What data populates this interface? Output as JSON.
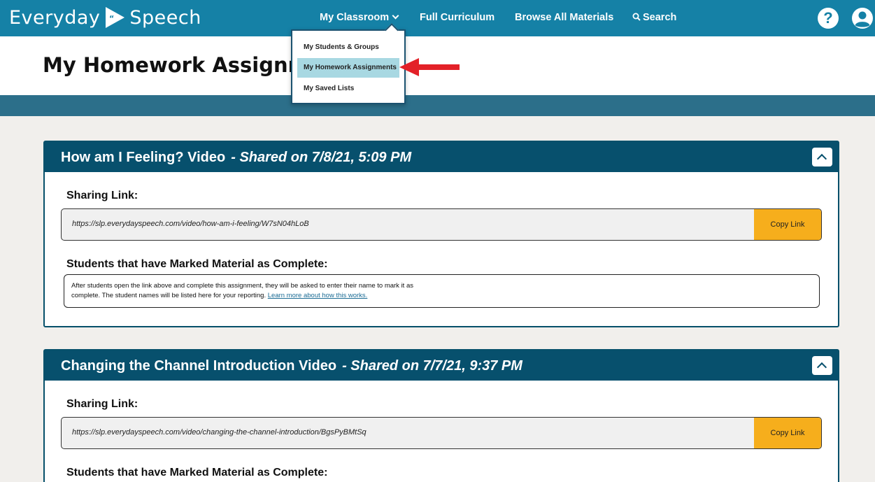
{
  "brand": {
    "name_left": "Everyday",
    "name_right": "Speech",
    "logo_icon": "play-quote-logo-icon"
  },
  "nav": {
    "my_classroom": "My Classroom",
    "full_curriculum": "Full Curriculum",
    "browse_all": "Browse All Materials",
    "search": "Search"
  },
  "dropdown": {
    "items": [
      "My Students & Groups",
      "My Homework Assignments",
      "My Saved Lists"
    ],
    "highlighted_index": 1
  },
  "page": {
    "title": "My Homework Assignments"
  },
  "assignments": [
    {
      "title": "How am I Feeling? Video",
      "shared": "- Shared on 7/8/21, 5:09 PM",
      "sharing_label": "Sharing Link:",
      "url": "https://slp.everydayspeech.com/video/how-am-i-feeling/W7sN04hLoB",
      "copy_label": "Copy Link",
      "students_label": "Students that have Marked Material as Complete:",
      "info_text_1": "After students open the link above and complete this assignment, they will be asked to enter their name to mark it as",
      "info_text_2": "complete. The student names will be listed here for your reporting.",
      "info_link": "Learn more about how this works."
    },
    {
      "title": "Changing the Channel Introduction Video",
      "shared": "- Shared on 7/7/21, 9:37 PM",
      "sharing_label": "Sharing Link:",
      "url": "https://slp.everydayspeech.com/video/changing-the-channel-introduction/BgsPyBMtSq",
      "copy_label": "Copy Link",
      "students_label": "Students that have Marked Material as Complete:"
    }
  ],
  "colors": {
    "nav_bg": "#1581a6",
    "card_header": "#07506d",
    "copy_button": "#f6ae1c",
    "highlight": "#a8d8e2",
    "arrow": "#e32128"
  }
}
